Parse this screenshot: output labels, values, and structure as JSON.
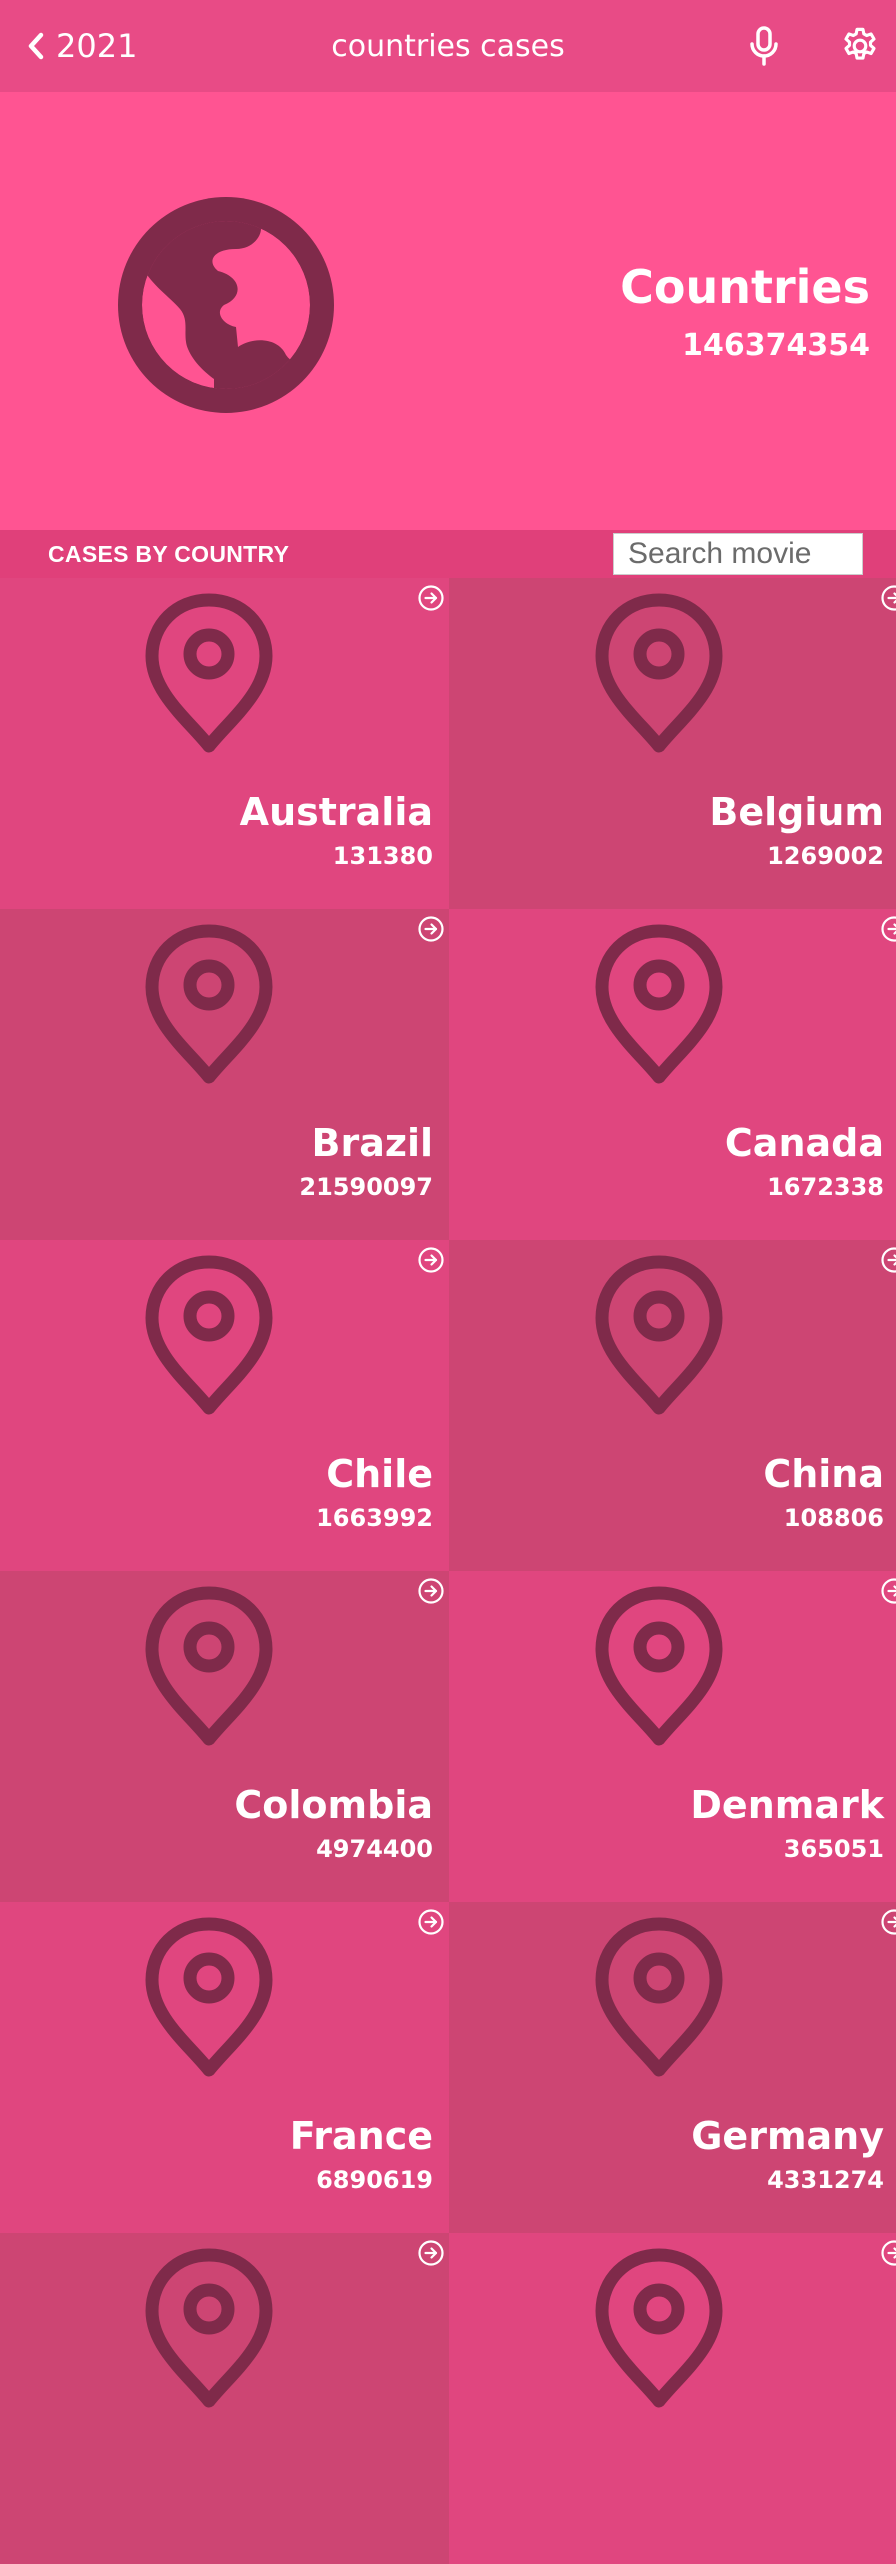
{
  "header": {
    "back_label": "2021",
    "title": "countries cases",
    "mic_icon": "microphone-icon",
    "settings_icon": "gear-icon"
  },
  "hero": {
    "icon": "globe-icon",
    "title": "Countries",
    "total": "146374354"
  },
  "section": {
    "title": "CASES BY COUNTRY",
    "search_placeholder": "Search movie"
  },
  "colors": {
    "topbar": "#e84b86",
    "hero": "#ff5492",
    "tile_light": "#e0467f",
    "tile_dark": "#cd4573",
    "icon": "#7f2a4a"
  },
  "countries": [
    {
      "name": "Australia",
      "cases": "131380"
    },
    {
      "name": "Belgium",
      "cases": "1269002"
    },
    {
      "name": "Brazil",
      "cases": "21590097"
    },
    {
      "name": "Canada",
      "cases": "1672338"
    },
    {
      "name": "Chile",
      "cases": "1663992"
    },
    {
      "name": "China",
      "cases": "108806"
    },
    {
      "name": "Colombia",
      "cases": "4974400"
    },
    {
      "name": "Denmark",
      "cases": "365051"
    },
    {
      "name": "France",
      "cases": "6890619"
    },
    {
      "name": "Germany",
      "cases": "4331274"
    }
  ]
}
